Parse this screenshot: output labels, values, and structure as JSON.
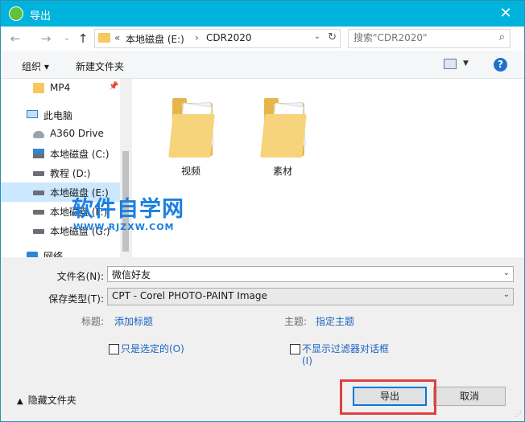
{
  "title": "导出",
  "address": {
    "prefix": "«",
    "crumbs": [
      "本地磁盘 (E:)",
      "CDR2020"
    ]
  },
  "search": {
    "placeholder": "搜索\"CDR2020\""
  },
  "toolbar": {
    "organize": "组织 ▾",
    "new_folder": "新建文件夹",
    "help": "?"
  },
  "sidebar": {
    "items": [
      {
        "label": "MP4",
        "icon": "folder-icon"
      },
      {
        "label": "此电脑",
        "icon": "computer-icon"
      },
      {
        "label": "A360 Drive",
        "icon": "cloud-drive-icon"
      },
      {
        "label": "本地磁盘 (C:)",
        "icon": "windows-drive-icon"
      },
      {
        "label": "教程 (D:)",
        "icon": "drive-icon"
      },
      {
        "label": "本地磁盘 (E:)",
        "icon": "drive-icon",
        "selected": true
      },
      {
        "label": "本地磁盘 (F:)",
        "icon": "drive-icon"
      },
      {
        "label": "本地磁盘 (G:)",
        "icon": "drive-icon"
      },
      {
        "label": "网络",
        "icon": "network-icon"
      }
    ]
  },
  "files": [
    {
      "name": "视频"
    },
    {
      "name": "素材"
    }
  ],
  "watermark": {
    "main": "软件自学网",
    "sub": "WWW.RJZXW.COM"
  },
  "form": {
    "filename_label": "文件名(N):",
    "filename_value": "微信好友",
    "filetype_label": "保存类型(T):",
    "filetype_value": "CPT - Corel PHOTO-PAINT Image",
    "tags_label": "标题:",
    "tags_link": "添加标题",
    "subject_label": "主题:",
    "subject_link": "指定主题",
    "selected_only": "只是选定的(O)",
    "no_filter_dialog_line1": "不显示过滤器对话框",
    "no_filter_dialog_line2": "(I)"
  },
  "footer": {
    "hide_folders": "隐藏文件夹",
    "export_button": "导出",
    "cancel_button": "取消"
  },
  "colors": {
    "titlebar": "#00b3dd",
    "selection": "#cce8ff",
    "link": "#1a64c0",
    "highlight": "#e04040",
    "watermark": "#1b7fe0"
  }
}
